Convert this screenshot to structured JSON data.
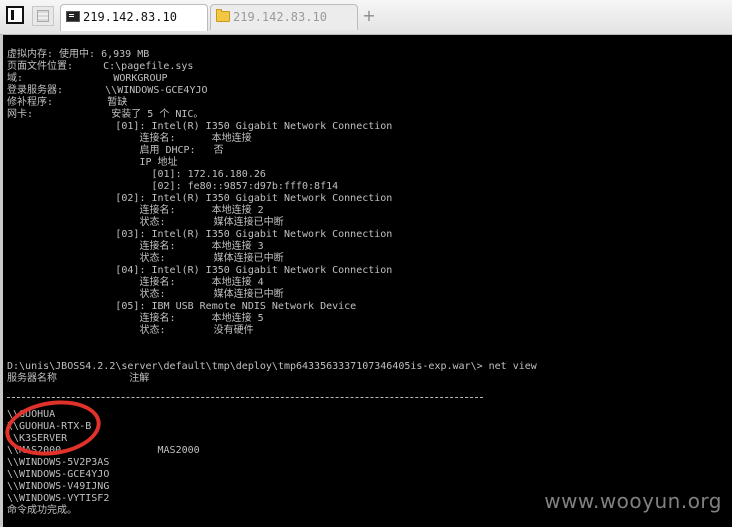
{
  "tabs": [
    {
      "label": "219.142.83.10",
      "icon": "terminal-icon",
      "active": true
    },
    {
      "label": "219.142.83.10",
      "icon": "folder-icon",
      "active": false
    }
  ],
  "toolbar": {
    "new_tab_symbol": "+"
  },
  "terminal": {
    "output": "虚拟内存: 使用中: 6,939 MB\n页面文件位置:     C:\\pagefile.sys\n域:               WORKGROUP\n登录服务器:       \\\\WINDOWS-GCE4YJO\n修补程序:         暂缺\n网卡:             安装了 5 个 NIC。\n                  [01]: Intel(R) I350 Gigabit Network Connection\n                      连接名:      本地连接\n                      启用 DHCP:   否\n                      IP 地址\n                        [01]: 172.16.180.26\n                        [02]: fe80::9857:d97b:fff0:8f14\n                  [02]: Intel(R) I350 Gigabit Network Connection\n                      连接名:      本地连接 2\n                      状态:        媒体连接已中断\n                  [03]: Intel(R) I350 Gigabit Network Connection\n                      连接名:      本地连接 3\n                      状态:        媒体连接已中断\n                  [04]: Intel(R) I350 Gigabit Network Connection\n                      连接名:      本地连接 4\n                      状态:        媒体连接已中断\n                  [05]: IBM USB Remote NDIS Network Device\n                      连接名:      本地连接 5\n                      状态:        没有硬件\n\n\nD:\\unis\\JBOSS4.2.2\\server\\default\\tmp\\deploy\\tmp6433563337107346405is-exp.war\\> net view\n服务器名称            注解\n\n\n\\\\GUOHUA\n\\\\GUOHUA-RTX-B\n\\\\K3SERVER\n\\\\MAS2000                MAS2000\n\\\\WINDOWS-5V2P3AS\n\\\\WINDOWS-GCE4YJO\n\\\\WINDOWS-V49IJNG\n\\\\WINDOWS-VYTISF2\n命令成功完成。"
  },
  "watermark": "www.wooyun.org"
}
